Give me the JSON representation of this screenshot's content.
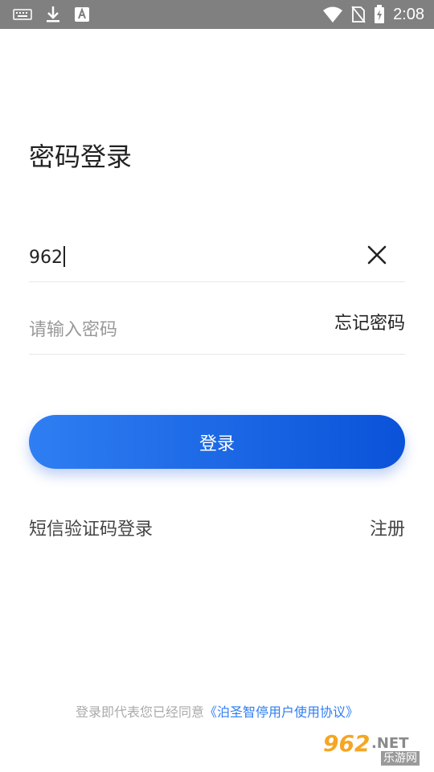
{
  "status_bar": {
    "time": "2:08",
    "icons": [
      "keyboard-icon",
      "download-icon",
      "text-a-icon",
      "wifi-icon",
      "no-sim-icon",
      "battery-charging-icon"
    ]
  },
  "login": {
    "title": "密码登录",
    "phone_value": "962",
    "password_placeholder": "请输入密码",
    "forgot_label": "忘记密码",
    "login_button_label": "登录",
    "sms_login_label": "短信验证码登录",
    "register_label": "注册"
  },
  "agreement": {
    "text": "登录即代表您已经同意",
    "link": "《泊圣智停用户使用协议》"
  },
  "watermark": {
    "number": "962",
    "domain": ".NET",
    "site_name": "乐游网"
  },
  "colors": {
    "accent_start": "#2f7ef2",
    "accent_end": "#0a53d9",
    "status_bar": "#808080",
    "link": "#2f7ef2"
  }
}
